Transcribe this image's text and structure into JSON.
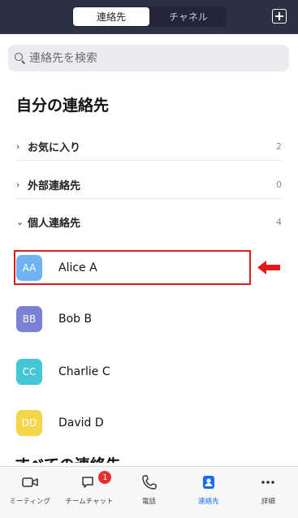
{
  "header": {
    "tabs": [
      {
        "label": "連絡先",
        "active": true
      },
      {
        "label": "チャネル",
        "active": false
      }
    ]
  },
  "search": {
    "placeholder": "連絡先を検索"
  },
  "main": {
    "title": "自分の連絡先",
    "groups": [
      {
        "label": "お気に入り",
        "count": "2",
        "expanded": false
      },
      {
        "label": "外部連絡先",
        "count": "0",
        "expanded": false
      },
      {
        "label": "個人連絡先",
        "count": "4",
        "expanded": true
      }
    ],
    "contacts": [
      {
        "initials": "AA",
        "name": "Alice A",
        "color": "#6fb3f2"
      },
      {
        "initials": "BB",
        "name": "Bob B",
        "color": "#7a80d4"
      },
      {
        "initials": "CC",
        "name": "Charlie C",
        "color": "#45c6d5"
      },
      {
        "initials": "DD",
        "name": "David D",
        "color": "#f4d64a"
      }
    ],
    "next_section": "すべての連絡先"
  },
  "bottom_nav": {
    "items": [
      {
        "label": "ミーティング",
        "icon": "video-camera-icon"
      },
      {
        "label": "チームチャット",
        "icon": "chat-bubble-icon",
        "badge": "1"
      },
      {
        "label": "電話",
        "icon": "phone-icon"
      },
      {
        "label": "連絡先",
        "icon": "contact-card-icon",
        "active": true
      },
      {
        "label": "詳細",
        "icon": "more-dots-icon"
      }
    ]
  },
  "colors": {
    "accent": "#1a6bf5",
    "header_bg": "#2d3146",
    "highlight": "#e3191b"
  }
}
